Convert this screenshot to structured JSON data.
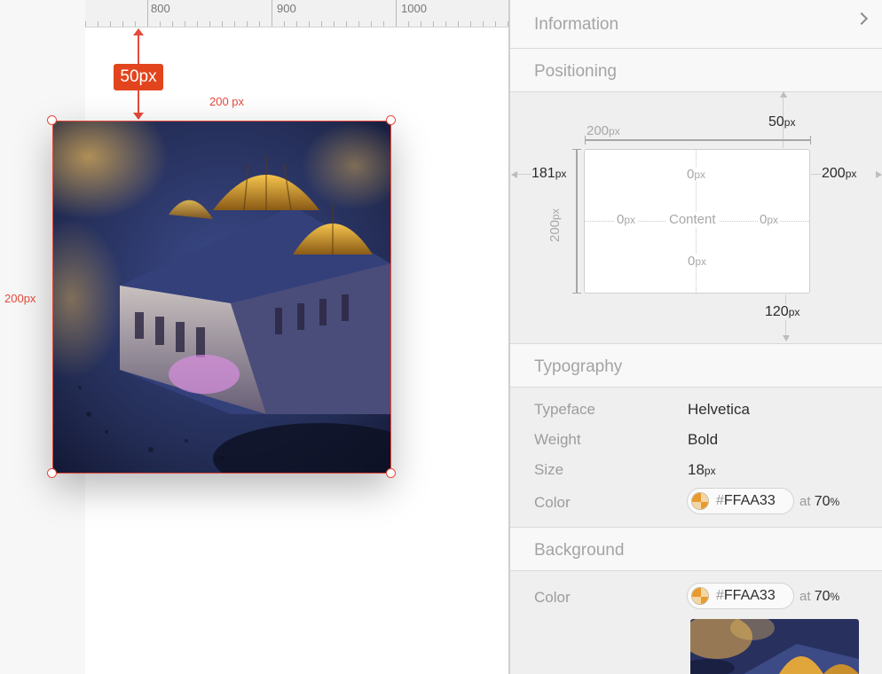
{
  "ruler": {
    "ticks": [
      "800",
      "900",
      "1000"
    ]
  },
  "canvas": {
    "spacing_badge": "50px",
    "width_label": "200 px",
    "height_label": "200px"
  },
  "panel": {
    "information": {
      "title": "Information"
    },
    "positioning": {
      "title": "Positioning",
      "width_value": "200",
      "width_unit": "px",
      "height_value": "200",
      "height_unit": "px",
      "top_value": "50",
      "top_unit": "px",
      "left_value": "181",
      "left_unit": "px",
      "right_value": "200",
      "right_unit": "px",
      "bottom_value": "120",
      "bottom_unit": "px",
      "padding_top": "0",
      "padding_left": "0",
      "padding_right": "0",
      "padding_bottom": "0",
      "padding_unit": "px",
      "content_label": "Content"
    },
    "typography": {
      "title": "Typography",
      "typeface_label": "Typeface",
      "typeface_value": "Helvetica",
      "weight_label": "Weight",
      "weight_value": "Bold",
      "size_label": "Size",
      "size_value": "18",
      "size_unit": "px",
      "color_label": "Color",
      "color_hash": "#",
      "color_hex": "FFAA33",
      "opacity_prefix": "at",
      "opacity_value": "70",
      "opacity_unit": "%"
    },
    "background": {
      "title": "Background",
      "color_label": "Color",
      "color_hash": "#",
      "color_hex": "FFAA33",
      "opacity_prefix": "at",
      "opacity_value": "70",
      "opacity_unit": "%"
    }
  },
  "colors": {
    "accent_red": "#e54a3c",
    "badge_red": "#e2451e",
    "swatch": "#FFAA33"
  }
}
